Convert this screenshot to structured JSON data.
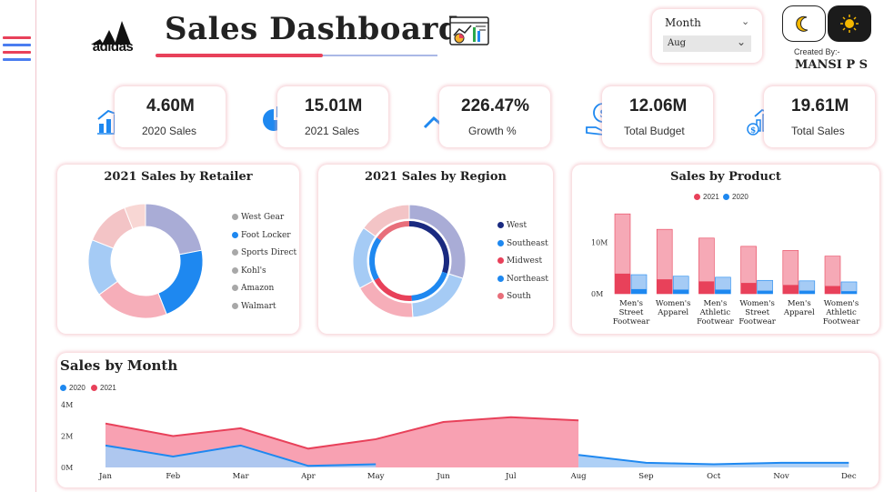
{
  "header": {
    "title": "Sales Dashboard",
    "brand": "adidas",
    "month_filter": {
      "label": "Month",
      "selected": "Aug"
    },
    "created_by_label": "Created By:-",
    "author": "MANSI P S"
  },
  "kpis": [
    {
      "value": "4.60M",
      "label": "2020 Sales"
    },
    {
      "value": "15.01M",
      "label": "2021 Sales"
    },
    {
      "value": "226.47%",
      "label": "Growth %"
    },
    {
      "value": "12.06M",
      "label": "Total Budget"
    },
    {
      "value": "19.61M",
      "label": "Total Sales"
    }
  ],
  "chart_data": [
    {
      "type": "pie",
      "title": "2021 Sales by Retailer",
      "labels": [
        "West Gear",
        "Foot Locker",
        "Sports Direct",
        "Kohl's",
        "Amazon",
        "Walmart"
      ],
      "values": [
        22,
        22,
        21,
        16,
        13,
        6
      ],
      "colors": [
        "#a9acd6",
        "#1e88f0",
        "#f6aeb9",
        "#a5cbf5",
        "#f3c4c6",
        "#f8d7d4"
      ],
      "legend_dot_colors": [
        "#a8a8a8",
        "#1e88f0",
        "#a8a8a8",
        "#a8a8a8",
        "#a8a8a8",
        "#a8a8a8"
      ],
      "legend": "right"
    },
    {
      "type": "pie",
      "title": "2021 Sales by Region",
      "labels": [
        "West",
        "Southeast",
        "Midwest",
        "Northeast",
        "South"
      ],
      "values": [
        30,
        19,
        18,
        18,
        15
      ],
      "colors": [
        "#a9acd6",
        "#a5cbf5",
        "#f6aeb9",
        "#a5cbf5",
        "#f3c4c6"
      ],
      "inner_ring_colors": [
        "#1a2a80",
        "#1e88f0",
        "#e8415a",
        "#1e88f0",
        "#e86e7a"
      ],
      "legend_dot_colors": [
        "#1a2a80",
        "#1e88f0",
        "#e8415a",
        "#1e88f0",
        "#e86e7a"
      ],
      "legend": "right"
    },
    {
      "type": "bar",
      "title": "Sales by Product",
      "categories": [
        [
          "Men's",
          "Street",
          "Footwear"
        ],
        [
          "Women's",
          "Apparel"
        ],
        [
          "Men's",
          "Athletic",
          "Footwear"
        ],
        [
          "Women's",
          "Street",
          "Footwear"
        ],
        [
          "Men's",
          "Apparel"
        ],
        [
          "Women's",
          "Athletic",
          "Footwear"
        ]
      ],
      "series": [
        {
          "name": "2021",
          "values": [
            15.5,
            12.5,
            10.8,
            9.2,
            8.4,
            7.3
          ],
          "highlight": [
            3.9,
            2.8,
            2.4,
            2.1,
            1.7,
            1.5
          ],
          "color": "#e8415a"
        },
        {
          "name": "2020",
          "values": [
            3.7,
            3.4,
            3.2,
            2.6,
            2.5,
            2.3
          ],
          "highlight": [
            0.9,
            0.8,
            0.8,
            0.6,
            0.6,
            0.5
          ],
          "color": "#1e88f0"
        }
      ],
      "yticks": [
        "0M",
        "10M"
      ],
      "ylim": [
        0,
        18
      ],
      "legend": "top"
    },
    {
      "type": "area",
      "title": "Sales by Month",
      "categories": [
        "Jan",
        "Feb",
        "Mar",
        "Apr",
        "May",
        "Jun",
        "Jul",
        "Aug",
        "Sep",
        "Oct",
        "Nov",
        "Dec"
      ],
      "series": [
        {
          "name": "2020",
          "values": [
            1.4,
            0.7,
            1.4,
            0.1,
            0.2,
            null,
            null,
            0.8,
            0.3,
            0.2,
            0.3,
            0.3
          ],
          "color": "#1e88f0"
        },
        {
          "name": "2021",
          "values": [
            2.8,
            2.0,
            2.5,
            1.2,
            1.8,
            2.9,
            3.2,
            3.0,
            null,
            null,
            null,
            null
          ],
          "color": "#e8415a"
        }
      ],
      "yticks": [
        "0M",
        "2M",
        "4M"
      ],
      "ylim": [
        0,
        4
      ],
      "legend": "top-left"
    }
  ]
}
